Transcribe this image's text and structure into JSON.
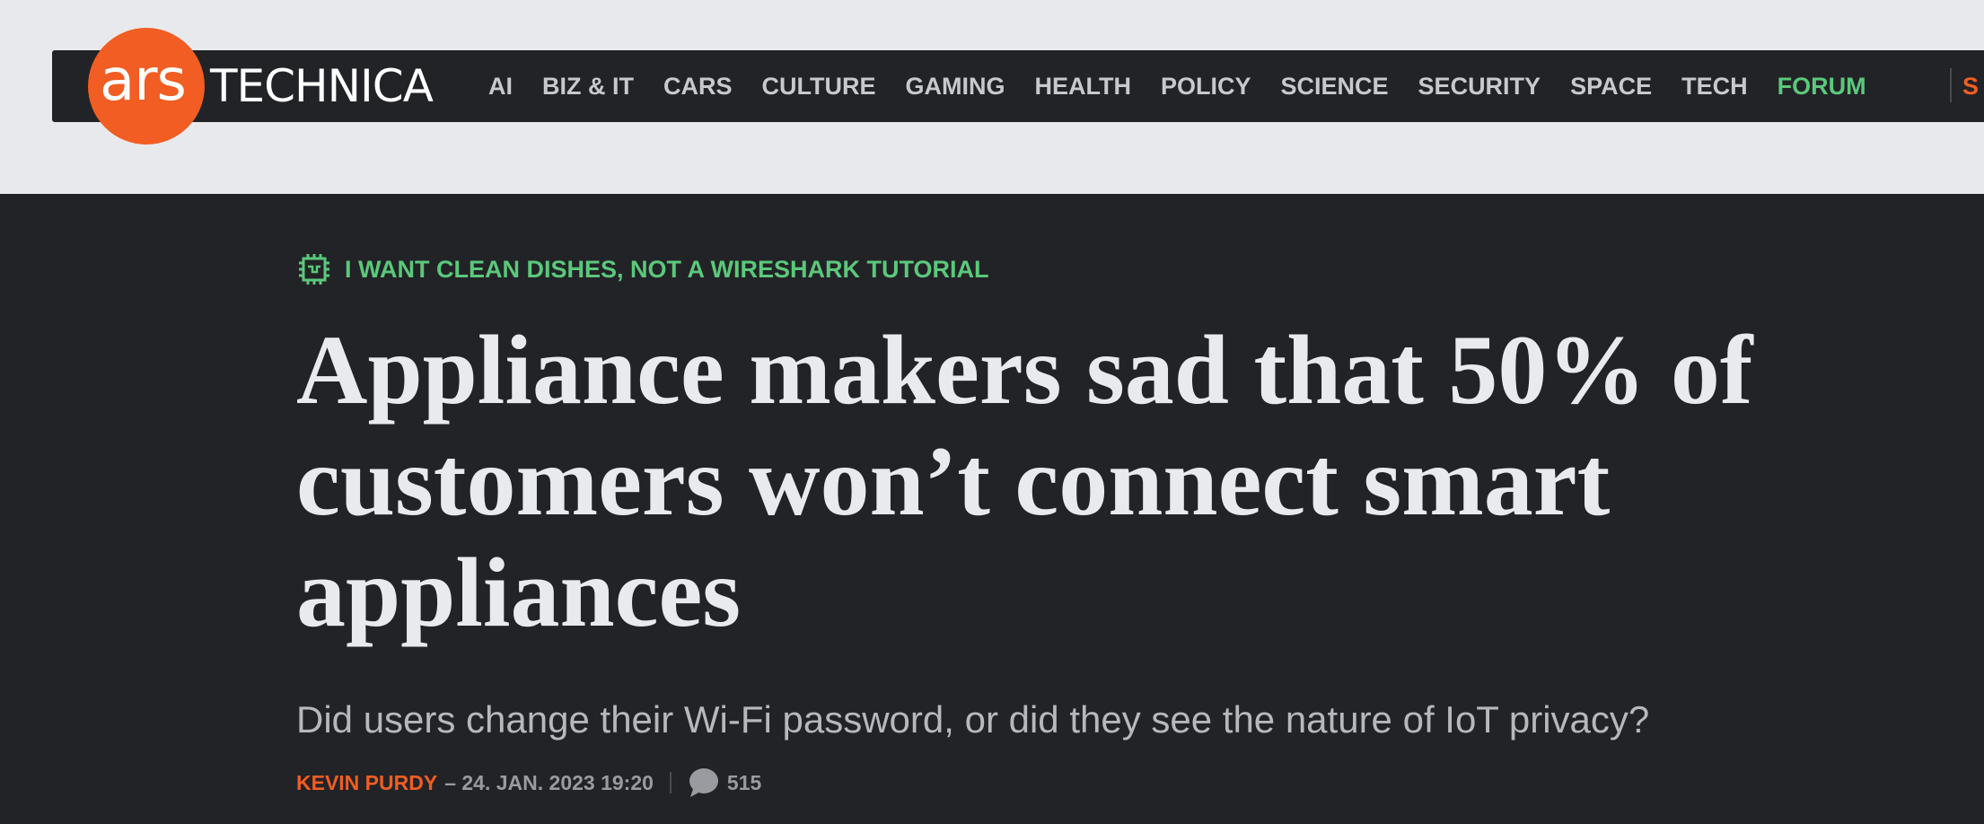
{
  "logo": {
    "ars": "ars",
    "technica": "TECHNICA"
  },
  "nav": {
    "items": [
      "AI",
      "BIZ & IT",
      "CARS",
      "CULTURE",
      "GAMING",
      "HEALTH",
      "POLICY",
      "SCIENCE",
      "SECURITY",
      "SPACE",
      "TECH"
    ],
    "forum": "FORUM",
    "extra_fragment": "S"
  },
  "article": {
    "kicker": "I WANT CLEAN DISHES, NOT A WIRESHARK TUTORIAL",
    "kicker_icon": "circuit-chip-icon",
    "headline": "Appliance makers sad that 50% of customers won’t connect smart appliances",
    "dek": "Did users change their Wi-Fi password, or did they see the nature of IoT privacy?",
    "author": "KEVIN PURDY",
    "dateline": "– 24. JAN. 2023 19:20",
    "comment_icon": "comment-bubble-icon",
    "comment_count": "515"
  },
  "colors": {
    "accent_orange": "#f15d22",
    "accent_green": "#5bc87b",
    "dark_background": "#222327",
    "light_background": "#e8e9ed"
  }
}
